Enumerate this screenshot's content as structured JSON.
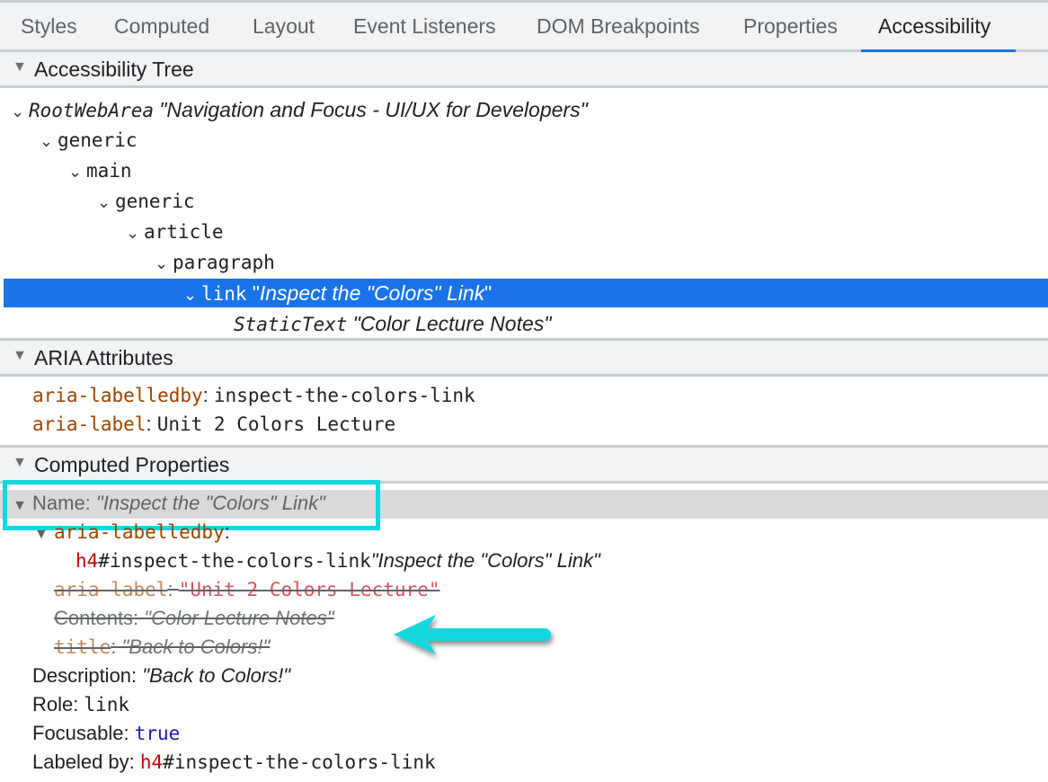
{
  "tabs": [
    {
      "label": "Styles",
      "active": false
    },
    {
      "label": "Computed",
      "active": false
    },
    {
      "label": "Layout",
      "active": false
    },
    {
      "label": "Event Listeners",
      "active": false
    },
    {
      "label": "DOM Breakpoints",
      "active": false
    },
    {
      "label": "Properties",
      "active": false
    },
    {
      "label": "Accessibility",
      "active": true
    }
  ],
  "sections": {
    "tree": "Accessibility Tree",
    "aria": "ARIA Attributes",
    "computed": "Computed Properties"
  },
  "tree": [
    {
      "role": "RootWebArea",
      "italic_role": true,
      "name": "\"Navigation and Focus - UI/UX for Developers\"",
      "expanded": true
    },
    {
      "role": "generic",
      "expanded": true
    },
    {
      "role": "main",
      "expanded": true
    },
    {
      "role": "generic",
      "expanded": true
    },
    {
      "role": "article",
      "expanded": true
    },
    {
      "role": "paragraph",
      "expanded": true
    },
    {
      "role": "link",
      "name_q1": "\"",
      "name": "Inspect the \"Colors\" Link",
      "name_q2": "\"",
      "expanded": true,
      "selected": true
    },
    {
      "role": "StaticText",
      "italic_role": true,
      "name": "\"Color Lecture Notes\""
    }
  ],
  "aria_attributes": [
    {
      "name": "aria-labelledby",
      "value": "inspect-the-colors-link"
    },
    {
      "name": "aria-label",
      "value": "Unit 2 Colors Lecture"
    }
  ],
  "computed": {
    "name_label": "Name: ",
    "name_value": "\"Inspect the \"Colors\" Link\"",
    "labelledby_label": "aria-labelledby",
    "labelledby_tag": "h4",
    "labelledby_id": "#inspect-the-colors-link",
    "labelledby_text": "\"Inspect the \"Colors\" Link\"",
    "overridden": {
      "aria_label_name": "aria-label",
      "aria_label_value": "\"Unit 2 Colors Lecture\"",
      "contents_label": "Contents: ",
      "contents_value": "\"Color Lecture Notes\"",
      "title_name": "title",
      "title_value": "\"Back to Colors!\""
    },
    "description_label": "Description: ",
    "description_value": "\"Back to Colors!\"",
    "role_label": "Role: ",
    "role_value": "link",
    "focusable_label": "Focusable: ",
    "focusable_value": "true",
    "labeled_by_label": "Labeled by: ",
    "labeled_by_tag": "h4",
    "labeled_by_id": "#inspect-the-colors-link"
  },
  "annotation": {
    "highlight_color": "#17d6e0",
    "arrow_color": "#17d6e0"
  }
}
